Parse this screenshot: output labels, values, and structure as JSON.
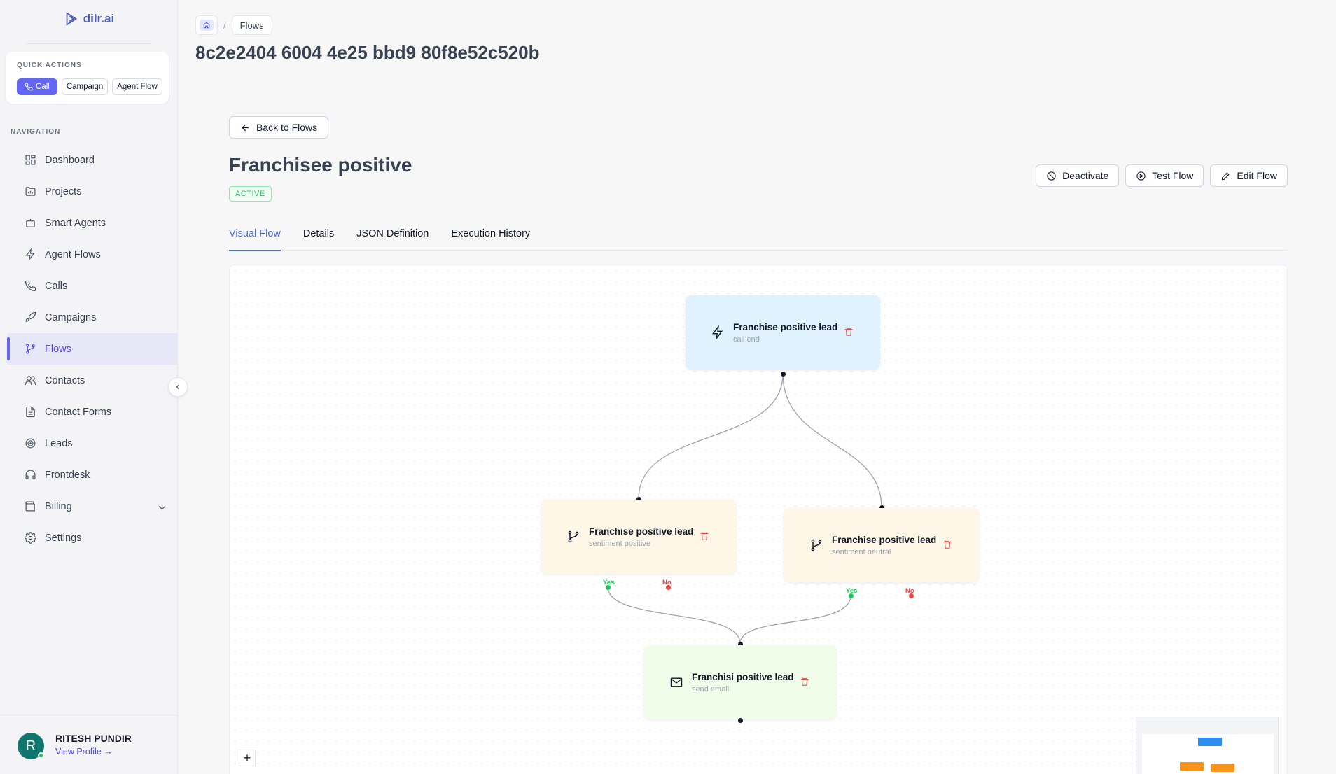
{
  "brand": {
    "name": "dilr.ai"
  },
  "quick_actions": {
    "title": "QUICK ACTIONS",
    "buttons": [
      "Call",
      "Campaign",
      "Agent Flow"
    ]
  },
  "navigation": {
    "title": "NAVIGATION",
    "items": [
      {
        "label": "Dashboard",
        "icon": "dashboard-icon"
      },
      {
        "label": "Projects",
        "icon": "folder-icon"
      },
      {
        "label": "Smart Agents",
        "icon": "bot-icon"
      },
      {
        "label": "Agent Flows",
        "icon": "bolt-icon"
      },
      {
        "label": "Calls",
        "icon": "phone-icon"
      },
      {
        "label": "Campaigns",
        "icon": "rocket-icon"
      },
      {
        "label": "Flows",
        "icon": "branch-icon",
        "active": true
      },
      {
        "label": "Contacts",
        "icon": "users-icon"
      },
      {
        "label": "Contact Forms",
        "icon": "form-icon"
      },
      {
        "label": "Leads",
        "icon": "target-icon"
      },
      {
        "label": "Frontdesk",
        "icon": "headset-icon"
      },
      {
        "label": "Billing",
        "icon": "wallet-icon"
      },
      {
        "label": "Settings",
        "icon": "gear-icon"
      }
    ]
  },
  "profile": {
    "initial": "R",
    "name": "RITESH PUNDIR",
    "link": "View Profile →"
  },
  "breadcrumb": {
    "current": "Flows"
  },
  "page": {
    "title": "8c2e2404 6004 4e25 bbd9 80f8e52c520b"
  },
  "flow": {
    "back_label": "Back to Flows",
    "name": "Franchisee positive",
    "status": "ACTIVE",
    "actions": [
      "Deactivate",
      "Test Flow",
      "Edit Flow"
    ],
    "tabs": [
      "Visual Flow",
      "Details",
      "JSON Definition",
      "Execution History"
    ],
    "active_tab": "Visual Flow"
  },
  "nodes": {
    "trigger": {
      "title": "Franchise positive lead",
      "subtitle": "call end",
      "icon": "bolt-icon",
      "color": "#e0f2fe"
    },
    "cond_positive": {
      "title": "Franchise positive lead",
      "subtitle": "sentiment positive",
      "icon": "branch-icon",
      "color": "#fef7e7"
    },
    "cond_neutral": {
      "title": "Franchise positive lead",
      "subtitle": "sentiment neutral",
      "icon": "branch-icon",
      "color": "#fef7e7"
    },
    "action_email": {
      "title": "Franchisi positive lead",
      "subtitle": "send email",
      "icon": "mail-icon",
      "color": "#f0fde8"
    }
  },
  "ports": {
    "yes": "Yes",
    "no": "No"
  },
  "canvas": {
    "zoom_in": "+"
  },
  "colors": {
    "accent": "#6366f1",
    "active_green": "#22c55e",
    "delete_red": "#ef4444",
    "minimap_trigger": "#2d8cf0",
    "minimap_cond": "#f7941d"
  }
}
